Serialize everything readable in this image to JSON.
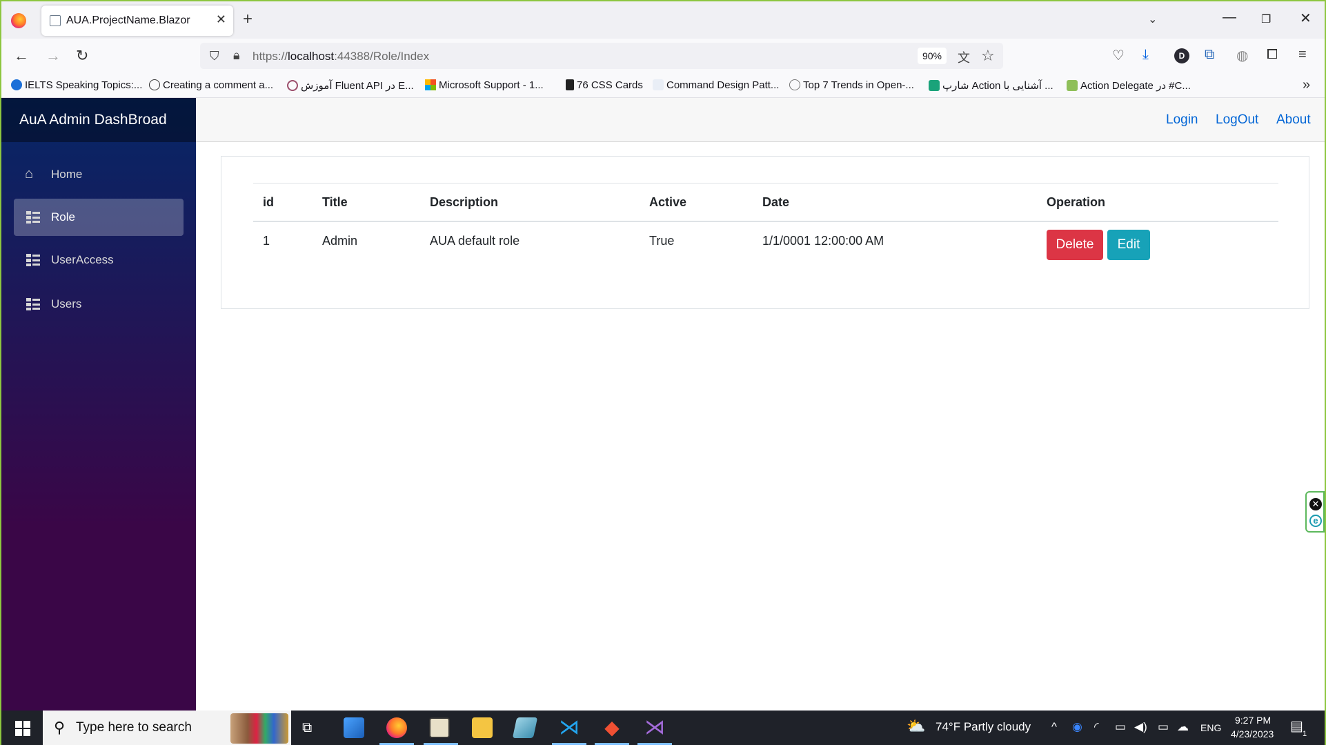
{
  "browser": {
    "tab_title": "AUA.ProjectName.Blazor",
    "url_prefix": "https://",
    "url_host": "localhost",
    "url_rest": ":44388/Role/Index",
    "zoom": "90%",
    "avatar_letter": "D"
  },
  "bookmarks": [
    "IELTS Speaking Topics:...",
    "Creating a comment a...",
    "آموزش Fluent API در E...",
    "Microsoft Support - 1...",
    "76 CSS Cards",
    "Command Design Patt...",
    "Top 7 Trends in Open-...",
    "شارپ Action آشنایی با ...",
    "Action Delegate در #C..."
  ],
  "app": {
    "brand": "AuA Admin DashBroad",
    "nav": [
      {
        "label": "Home",
        "icon": "home-icon",
        "active": false
      },
      {
        "label": "Role",
        "icon": "list-icon",
        "active": true
      },
      {
        "label": "UserAccess",
        "icon": "list-icon",
        "active": false
      },
      {
        "label": "Users",
        "icon": "list-icon",
        "active": false
      }
    ],
    "top_links": {
      "login": "Login",
      "logout": "LogOut",
      "about": "About"
    }
  },
  "table": {
    "headers": {
      "id": "id",
      "title": "Title",
      "description": "Description",
      "active": "Active",
      "date": "Date",
      "operation": "Operation"
    },
    "rows": [
      {
        "id": "1",
        "title": "Admin",
        "description": "AUA default role",
        "active": "True",
        "date": "1/1/0001 12:00:00 AM",
        "delete_label": "Delete",
        "edit_label": "Edit"
      }
    ]
  },
  "taskbar": {
    "search_placeholder": "Type here to search",
    "weather": "74°F  Partly cloudy",
    "lang": "ENG",
    "time": "9:27 PM",
    "date": "4/23/2023",
    "notifications": "1"
  },
  "colors": {
    "delete": "#dc3545",
    "edit": "#17a2b8",
    "link": "#0366d6",
    "sidebar_top": "#052767",
    "sidebar_bottom": "#3a0647"
  }
}
